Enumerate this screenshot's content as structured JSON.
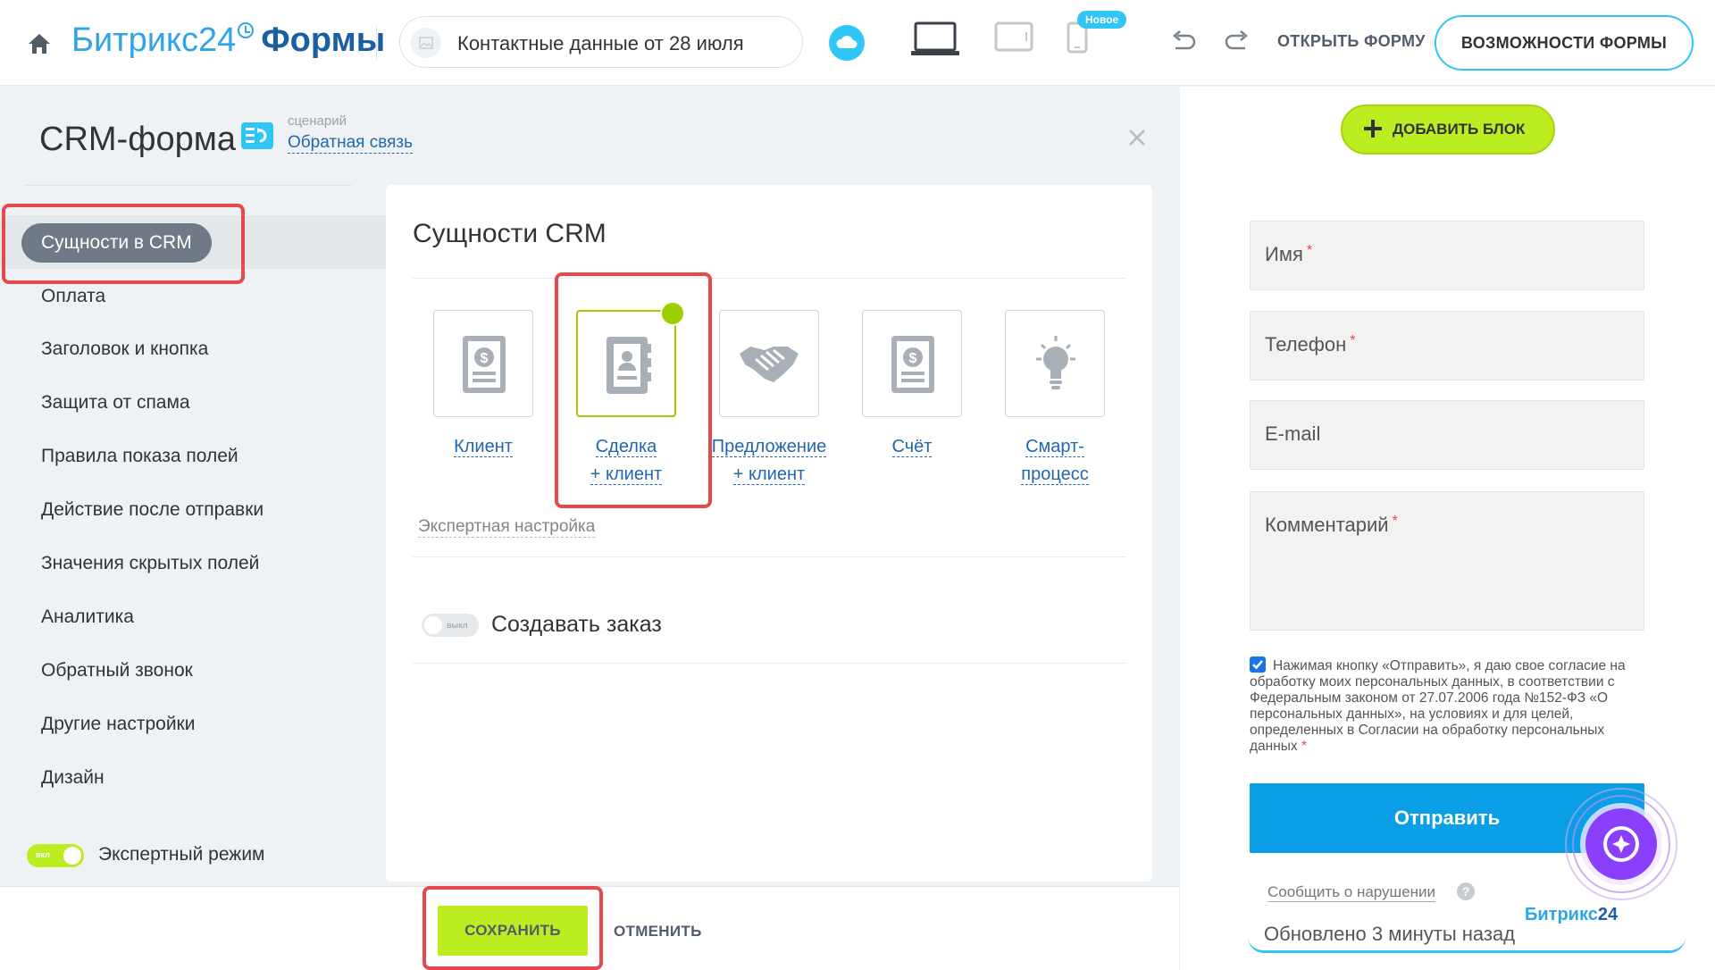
{
  "topbar": {
    "logo_brand": "Битрикс24",
    "logo_product": "Формы",
    "form_name": "Контактные данные от 28 июля",
    "new_badge": "Новое",
    "open_form": "ОТКРЫТЬ ФОРМУ",
    "features": "ВОЗМОЖНОСТИ ФОРМЫ"
  },
  "panel": {
    "title": "CRM-форма",
    "scenario_caption": "сценарий",
    "scenario_value": "Обратная связь"
  },
  "nav": {
    "active": "Сущности в CRM",
    "items": [
      "Оплата",
      "Заголовок и кнопка",
      "Защита от спама",
      "Правила показа полей",
      "Действие после отправки",
      "Значения скрытых полей",
      "Аналитика",
      "Обратный звонок",
      "Другие настройки",
      "Дизайн"
    ],
    "expert_mode": "Экспертный режим",
    "expert_toggle": "вкл"
  },
  "card": {
    "title": "Сущности CRM",
    "entities": [
      {
        "line1": "Клиент",
        "line2": "",
        "icon": "contact-dollar-icon"
      },
      {
        "line1": "Сделка",
        "line2": "+ клиент",
        "icon": "deal-contact-icon",
        "selected": true
      },
      {
        "line1": "Предложение",
        "line2": "+ клиент",
        "icon": "handshake-icon"
      },
      {
        "line1": "Счёт",
        "line2": "",
        "icon": "invoice-dollar-icon"
      },
      {
        "line1": "Смарт-",
        "line2": "процесс",
        "icon": "lightbulb-icon"
      }
    ],
    "expert_setup": "Экспертная настройка",
    "order_toggle": "выкл",
    "order_label": "Создавать заказ"
  },
  "bottom": {
    "save": "СОХРАНИТЬ",
    "cancel": "ОТМЕНИТЬ"
  },
  "preview": {
    "add_block": "ДОБАВИТЬ БЛОК",
    "fields": [
      "Имя",
      "Телефон",
      "E-mail",
      "Комментарий"
    ],
    "consent": "Нажимая кнопку «Отправить», я даю свое согласие на обработку моих персональных данных, в соответствии с Федеральным законом от 27.07.2006 года №152-ФЗ «О персональных данных», на условиях и для целей, определенных в Согласии на обработку персональных данных",
    "send": "Отправить",
    "report": "Сообщить о нарушении",
    "brand_mini": "Битрикс",
    "brand_mini_num": "24",
    "updated": "Обновлено 3 минуты назад"
  },
  "colors": {
    "accent_blue": "#2fc6f6",
    "link_blue": "#2067b0",
    "green": "#bbed21",
    "highlight_red": "#e5484d",
    "send_blue": "#0a9ee6"
  }
}
